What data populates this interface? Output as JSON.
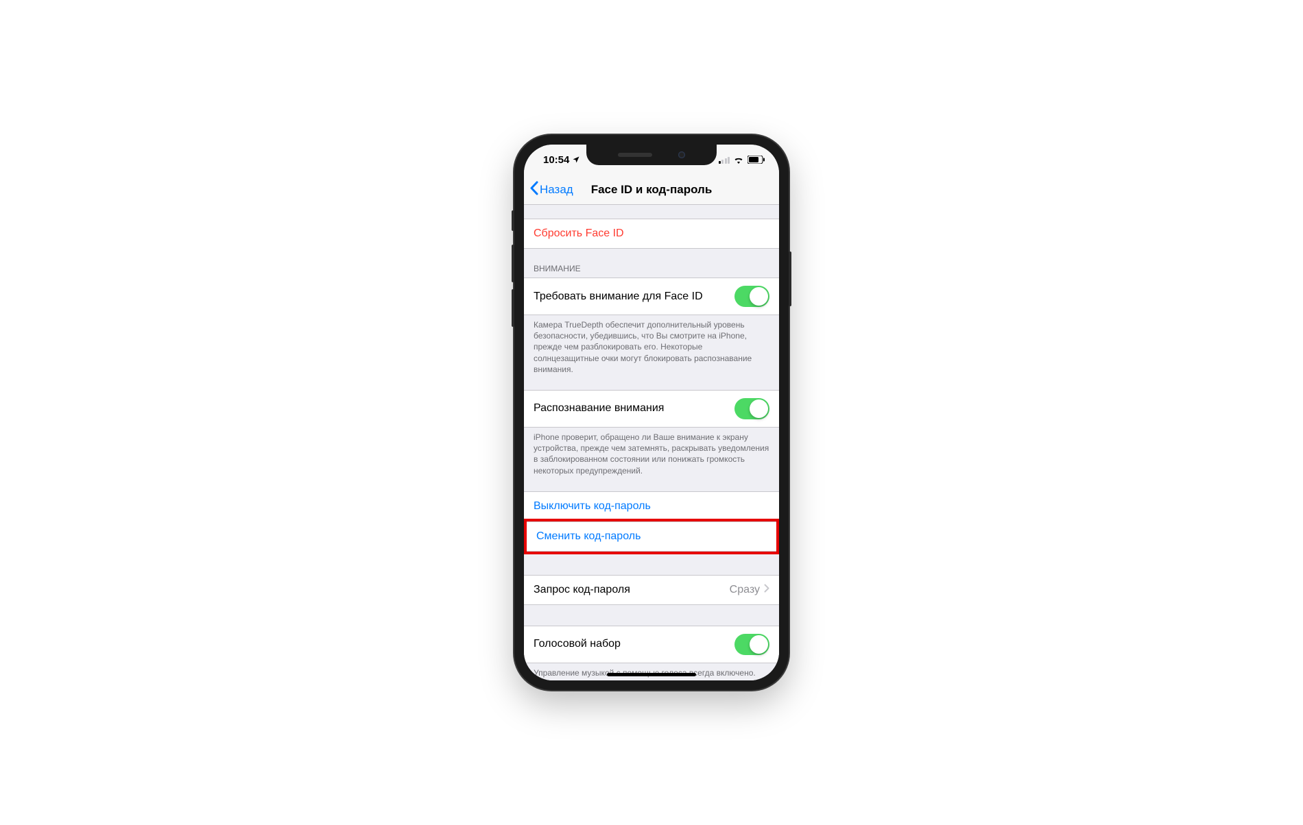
{
  "statusBar": {
    "time": "10:54"
  },
  "nav": {
    "back": "Назад",
    "title": "Face ID и код-пароль"
  },
  "resetFaceId": {
    "label": "Сбросить Face ID"
  },
  "attentionHeader": "ВНИМАНИЕ",
  "requireAttention": {
    "label": "Требовать внимание для Face ID",
    "footer": "Камера TrueDepth обеспечит дополнительный уровень безопасности, убедившись, что Вы смотрите на iPhone, прежде чем разблокировать его. Некоторые солнцезащитные очки могут блокировать распознавание внимания."
  },
  "attentionAware": {
    "label": "Распознавание внимания",
    "footer": "iPhone проверит, обращено ли Ваше внимание к экрану устройства, прежде чем затемнять, раскрывать уведомления в заблокированном состоянии или понижать громкость некоторых предупреждений."
  },
  "passcode": {
    "turnOff": "Выключить код-пароль",
    "change": "Сменить код-пароль"
  },
  "requirePasscode": {
    "label": "Запрос код-пароля",
    "value": "Сразу"
  },
  "voiceDial": {
    "label": "Голосовой набор",
    "footer": "Управление музыкой с помощью голоса всегда включено."
  }
}
